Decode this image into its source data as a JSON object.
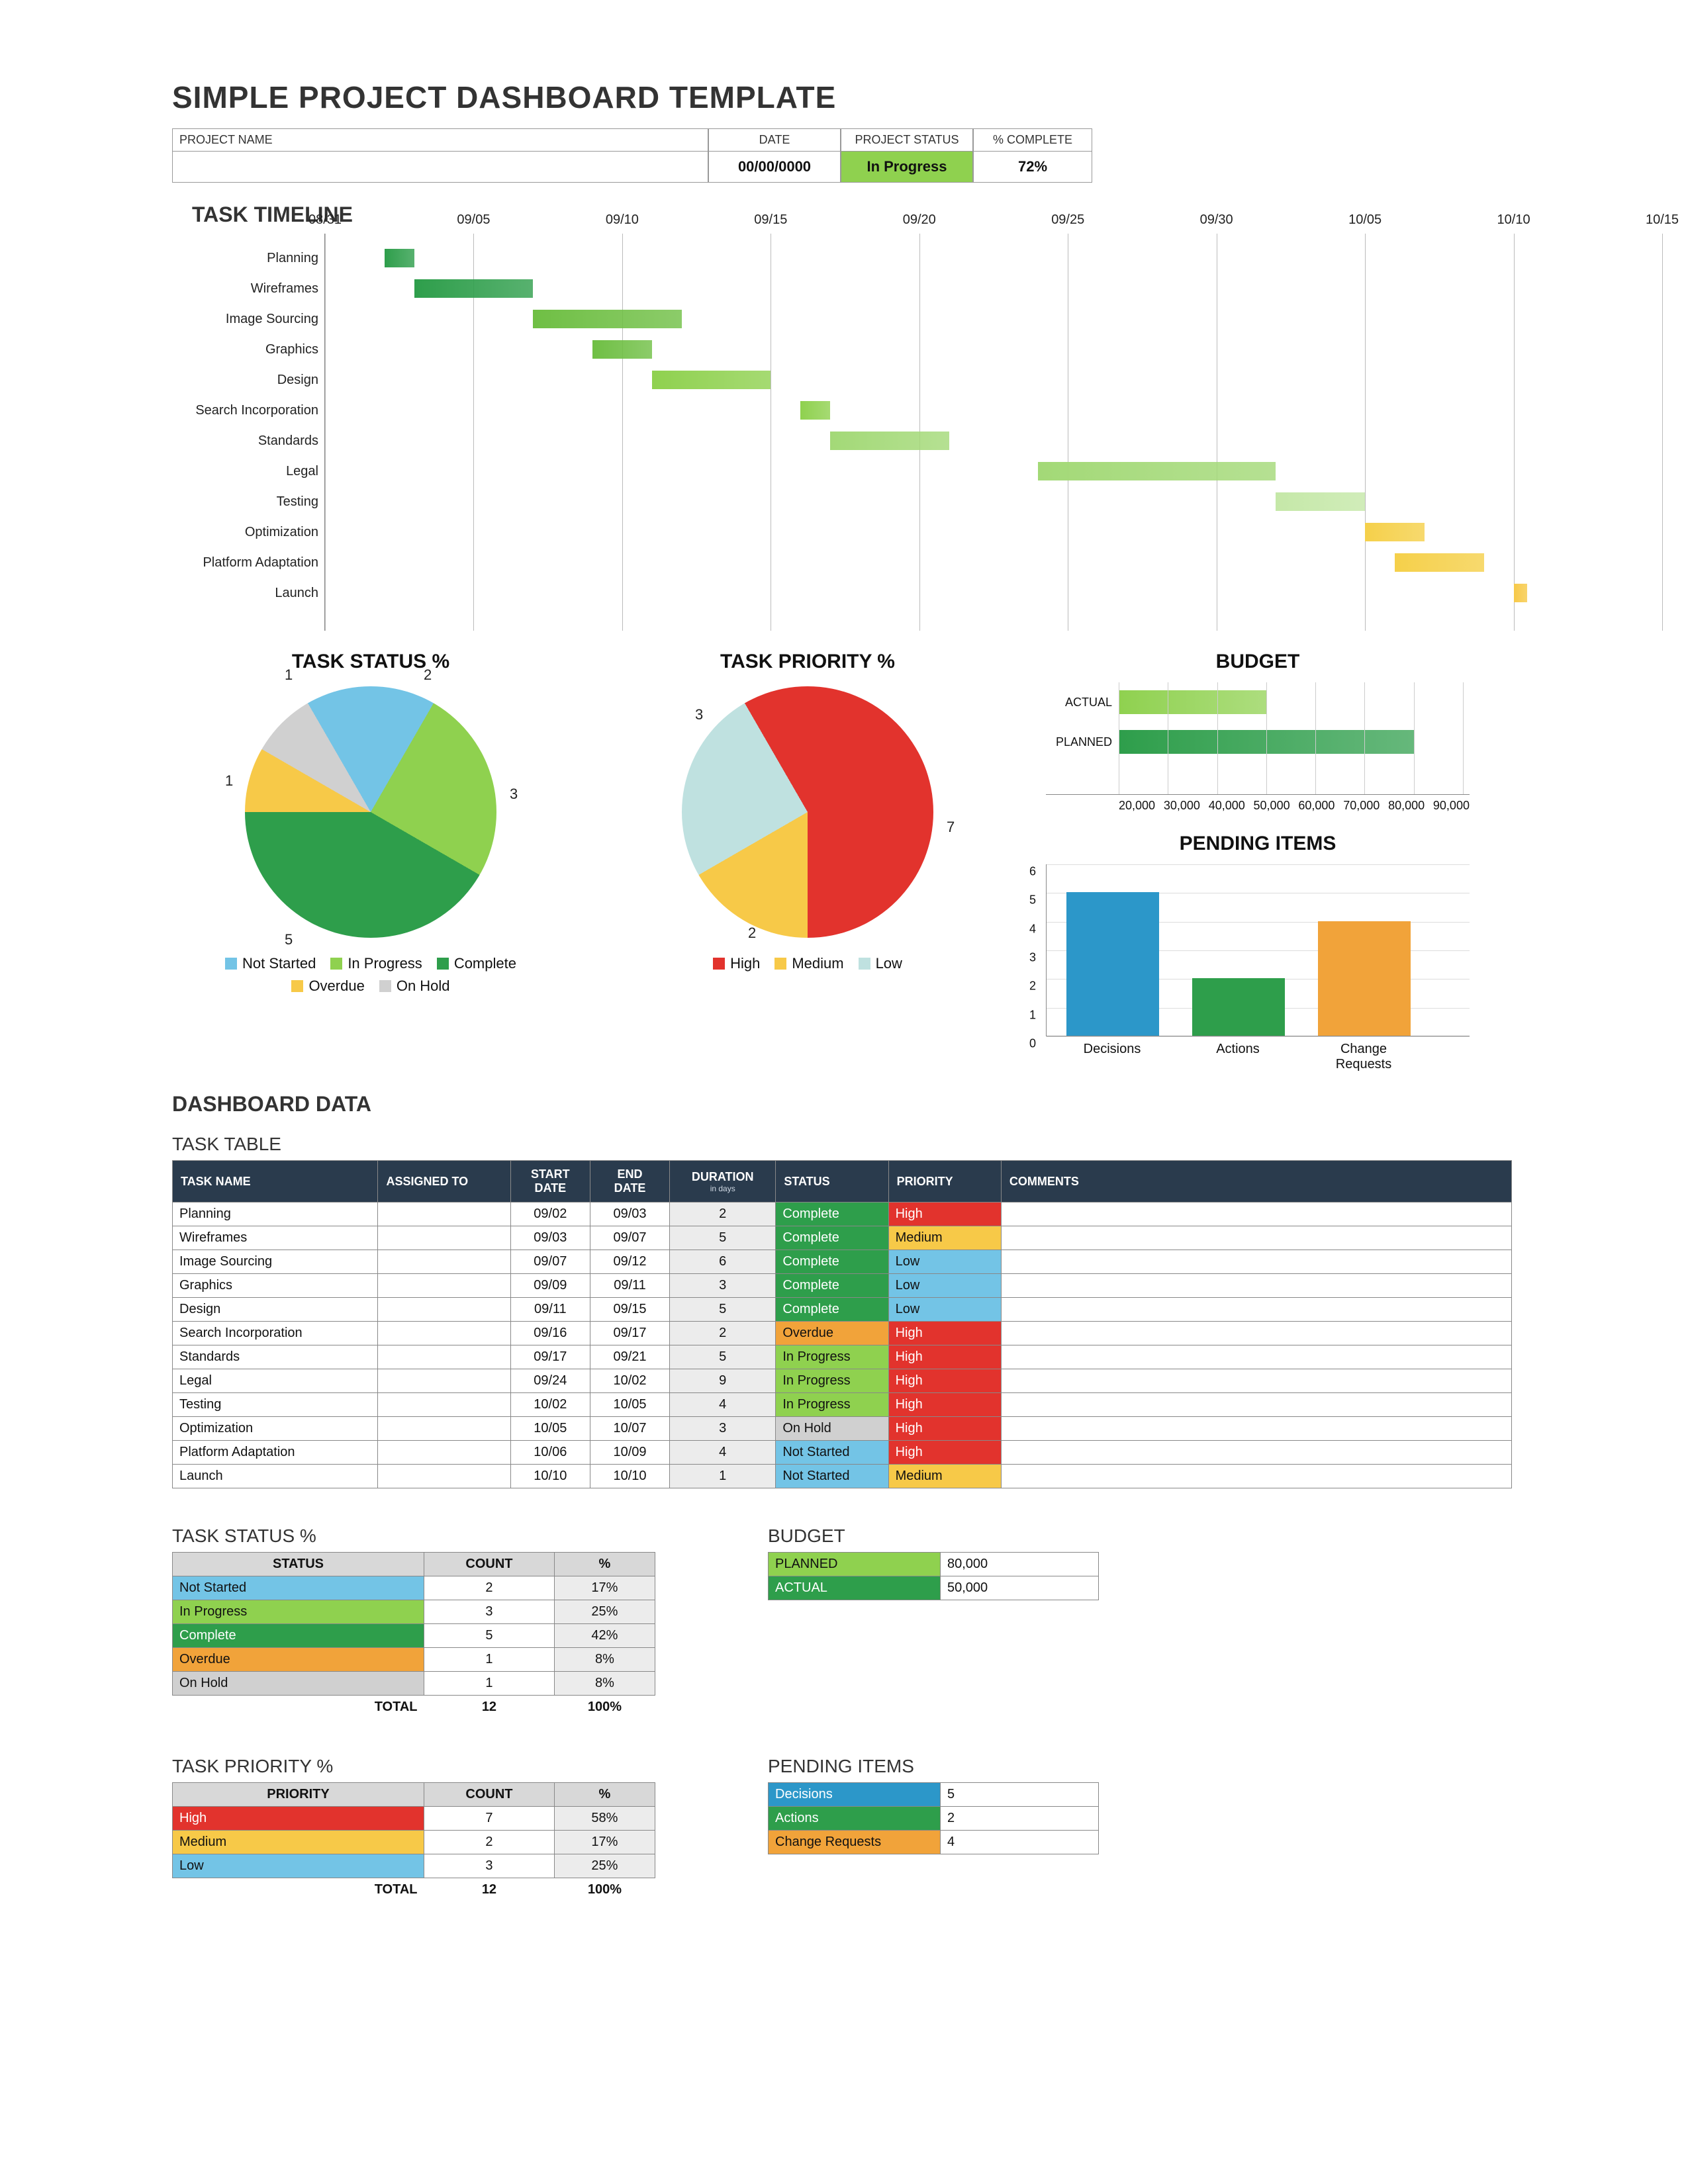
{
  "title": "SIMPLE PROJECT DASHBOARD TEMPLATE",
  "header": {
    "labels": {
      "project_name": "PROJECT NAME",
      "date": "DATE",
      "status": "PROJECT  STATUS",
      "pct": "% COMPLETE"
    },
    "values": {
      "project_name": "",
      "date": "00/00/0000",
      "status": "In Progress",
      "pct": "72%"
    }
  },
  "sections": {
    "timeline": "TASK TIMELINE",
    "status_pie": "TASK STATUS %",
    "priority_pie": "TASK PRIORITY %",
    "budget": "BUDGET",
    "pending": "PENDING ITEMS",
    "dashboard_data": "DASHBOARD DATA",
    "task_table": "TASK TABLE",
    "status_table": "TASK STATUS %",
    "priority_table": "TASK PRIORITY %",
    "budget_table": "BUDGET",
    "pending_table": "PENDING ITEMS"
  },
  "chart_data": [
    {
      "type": "bar",
      "orientation": "horizontal",
      "name": "TASK TIMELINE",
      "x_axis": "date",
      "x_ticks": [
        "08/31",
        "09/05",
        "09/10",
        "09/15",
        "09/20",
        "09/25",
        "09/30",
        "10/05",
        "10/10",
        "10/15"
      ],
      "tasks": [
        {
          "label": "Planning",
          "start": "09/02",
          "end": "09/03",
          "color": "#2e9e4b"
        },
        {
          "label": "Wireframes",
          "start": "09/03",
          "end": "09/07",
          "color": "#2e9e4b"
        },
        {
          "label": "Image Sourcing",
          "start": "09/07",
          "end": "09/12",
          "color": "#6fbf44"
        },
        {
          "label": "Graphics",
          "start": "09/09",
          "end": "09/11",
          "color": "#6fbf44"
        },
        {
          "label": "Design",
          "start": "09/11",
          "end": "09/15",
          "color": "#8fd14f"
        },
        {
          "label": "Search Incorporation",
          "start": "09/16",
          "end": "09/17",
          "color": "#8fd14f"
        },
        {
          "label": "Standards",
          "start": "09/17",
          "end": "09/21",
          "color": "#a3d977"
        },
        {
          "label": "Legal",
          "start": "09/24",
          "end": "10/02",
          "color": "#a3d977"
        },
        {
          "label": "Testing",
          "start": "10/02",
          "end": "10/05",
          "color": "#c5e8a8"
        },
        {
          "label": "Optimization",
          "start": "10/05",
          "end": "10/07",
          "color": "#f5d04a"
        },
        {
          "label": "Platform Adaptation",
          "start": "10/06",
          "end": "10/09",
          "color": "#f5d04a"
        },
        {
          "label": "Launch",
          "start": "10/10",
          "end": "10/10",
          "color": "#f7c948"
        }
      ]
    },
    {
      "type": "pie",
      "name": "TASK STATUS %",
      "slices": [
        {
          "label": "Not Started",
          "value": 2,
          "color": "#73c4e6"
        },
        {
          "label": "In Progress",
          "value": 3,
          "color": "#8fd14f"
        },
        {
          "label": "Complete",
          "value": 5,
          "color": "#2e9e4b"
        },
        {
          "label": "Overdue",
          "value": 1,
          "color": "#f7c948"
        },
        {
          "label": "On Hold",
          "value": 1,
          "color": "#d0d0d0"
        }
      ],
      "total": 12
    },
    {
      "type": "pie",
      "name": "TASK PRIORITY %",
      "slices": [
        {
          "label": "High",
          "value": 7,
          "color": "#e2332d"
        },
        {
          "label": "Medium",
          "value": 2,
          "color": "#f7c948"
        },
        {
          "label": "Low",
          "value": 3,
          "color": "#bfe1e0"
        }
      ],
      "total": 12
    },
    {
      "type": "bar",
      "orientation": "horizontal",
      "name": "BUDGET",
      "categories": [
        "ACTUAL",
        "PLANNED"
      ],
      "values": [
        50000,
        80000
      ],
      "colors": [
        "#8fd14f",
        "#2e9e4b"
      ],
      "xlim": [
        20000,
        90000
      ],
      "x_ticks": [
        "20,000",
        "30,000",
        "40,000",
        "50,000",
        "60,000",
        "70,000",
        "80,000",
        "90,000"
      ]
    },
    {
      "type": "bar",
      "name": "PENDING ITEMS",
      "categories": [
        "Decisions",
        "Actions",
        "Change Requests"
      ],
      "values": [
        5,
        2,
        4
      ],
      "colors": [
        "#2c97c9",
        "#2e9e4b",
        "#f1a33a"
      ],
      "ylim": [
        0,
        6
      ],
      "y_ticks": [
        0,
        1,
        2,
        3,
        4,
        5,
        6
      ]
    }
  ],
  "task_table": {
    "columns": [
      "TASK NAME",
      "ASSIGNED TO",
      "START DATE",
      "END DATE",
      "DURATION",
      "in days",
      "STATUS",
      "PRIORITY",
      "COMMENTS"
    ],
    "rows": [
      {
        "name": "Planning",
        "assigned": "",
        "start": "09/02",
        "end": "09/03",
        "dur": "2",
        "status": "Complete",
        "priority": "High",
        "comments": ""
      },
      {
        "name": "Wireframes",
        "assigned": "",
        "start": "09/03",
        "end": "09/07",
        "dur": "5",
        "status": "Complete",
        "priority": "Medium",
        "comments": ""
      },
      {
        "name": "Image Sourcing",
        "assigned": "",
        "start": "09/07",
        "end": "09/12",
        "dur": "6",
        "status": "Complete",
        "priority": "Low",
        "comments": ""
      },
      {
        "name": "Graphics",
        "assigned": "",
        "start": "09/09",
        "end": "09/11",
        "dur": "3",
        "status": "Complete",
        "priority": "Low",
        "comments": ""
      },
      {
        "name": "Design",
        "assigned": "",
        "start": "09/11",
        "end": "09/15",
        "dur": "5",
        "status": "Complete",
        "priority": "Low",
        "comments": ""
      },
      {
        "name": "Search Incorporation",
        "assigned": "",
        "start": "09/16",
        "end": "09/17",
        "dur": "2",
        "status": "Overdue",
        "priority": "High",
        "comments": ""
      },
      {
        "name": "Standards",
        "assigned": "",
        "start": "09/17",
        "end": "09/21",
        "dur": "5",
        "status": "In Progress",
        "priority": "High",
        "comments": ""
      },
      {
        "name": "Legal",
        "assigned": "",
        "start": "09/24",
        "end": "10/02",
        "dur": "9",
        "status": "In Progress",
        "priority": "High",
        "comments": ""
      },
      {
        "name": "Testing",
        "assigned": "",
        "start": "10/02",
        "end": "10/05",
        "dur": "4",
        "status": "In Progress",
        "priority": "High",
        "comments": ""
      },
      {
        "name": "Optimization",
        "assigned": "",
        "start": "10/05",
        "end": "10/07",
        "dur": "3",
        "status": "On Hold",
        "priority": "High",
        "comments": ""
      },
      {
        "name": "Platform Adaptation",
        "assigned": "",
        "start": "10/06",
        "end": "10/09",
        "dur": "4",
        "status": "Not Started",
        "priority": "High",
        "comments": ""
      },
      {
        "name": "Launch",
        "assigned": "",
        "start": "10/10",
        "end": "10/10",
        "dur": "1",
        "status": "Not Started",
        "priority": "Medium",
        "comments": ""
      }
    ]
  },
  "status_table": {
    "columns": [
      "STATUS",
      "COUNT",
      "%"
    ],
    "rows": [
      {
        "label": "Not Started",
        "count": "2",
        "pct": "17%",
        "cls": "c-cyan"
      },
      {
        "label": "In Progress",
        "count": "3",
        "pct": "25%",
        "cls": "c-green3"
      },
      {
        "label": "Complete",
        "count": "5",
        "pct": "42%",
        "cls": "c-green1"
      },
      {
        "label": "Overdue",
        "count": "1",
        "pct": "8%",
        "cls": "c-orange"
      },
      {
        "label": "On Hold",
        "count": "1",
        "pct": "8%",
        "cls": "c-grey"
      }
    ],
    "total": {
      "label": "TOTAL",
      "count": "12",
      "pct": "100%"
    }
  },
  "priority_table": {
    "columns": [
      "PRIORITY",
      "COUNT",
      "%"
    ],
    "rows": [
      {
        "label": "High",
        "count": "7",
        "pct": "58%",
        "cls": "c-red"
      },
      {
        "label": "Medium",
        "count": "2",
        "pct": "17%",
        "cls": "c-yellow"
      },
      {
        "label": "Low",
        "count": "3",
        "pct": "25%",
        "cls": "c-cyan"
      }
    ],
    "total": {
      "label": "TOTAL",
      "count": "12",
      "pct": "100%"
    }
  },
  "budget_table": {
    "rows": [
      {
        "label": "PLANNED",
        "value": "80,000",
        "cls": "c-green3"
      },
      {
        "label": "ACTUAL",
        "value": "50,000",
        "cls": "c-green1"
      }
    ]
  },
  "pending_table": {
    "rows": [
      {
        "label": "Decisions",
        "value": "5",
        "cls": "c-blue"
      },
      {
        "label": "Actions",
        "value": "2",
        "cls": "c-green1"
      },
      {
        "label": "Change Requests",
        "value": "4",
        "cls": "c-orange"
      }
    ]
  },
  "status_colors": {
    "Complete": "c-green1",
    "In Progress": "c-green3",
    "Overdue": "c-orange",
    "On Hold": "c-grey",
    "Not Started": "c-cyan"
  },
  "priority_colors": {
    "High": "c-red",
    "Medium": "c-yellow",
    "Low": "c-cyan"
  }
}
